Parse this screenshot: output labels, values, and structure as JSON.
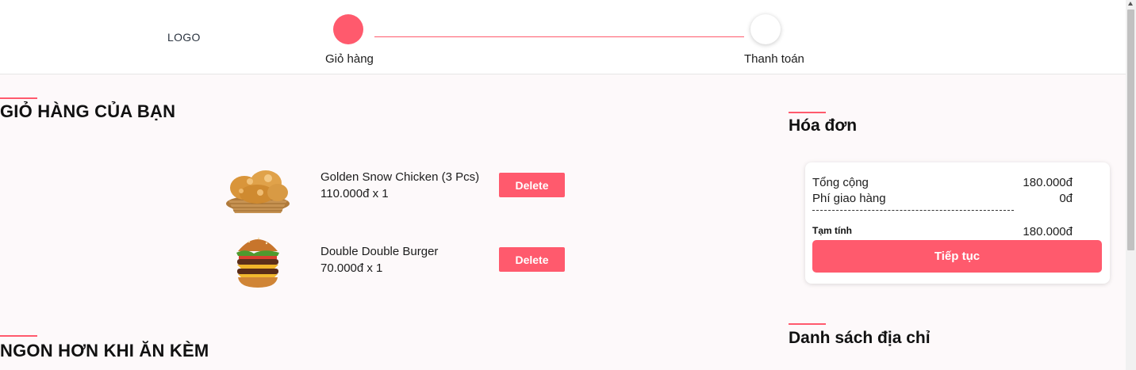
{
  "header": {
    "logo": "LOGO",
    "steps": [
      {
        "label": "Giỏ hàng",
        "active": true
      },
      {
        "label": "Thanh toán",
        "active": false
      }
    ]
  },
  "cart": {
    "title": "GIỎ HÀNG CỦA BẠN",
    "items": [
      {
        "name": "Golden Snow Chicken (3 Pcs)",
        "price_line": "110.000đ x 1",
        "delete_label": "Delete",
        "image": "fried-chicken-basket"
      },
      {
        "name": "Double Double Burger",
        "price_line": "70.000đ x 1",
        "delete_label": "Delete",
        "image": "double-burger"
      }
    ]
  },
  "sides": {
    "title": "NGON HƠN KHI ĂN KÈM"
  },
  "bill": {
    "title": "Hóa đơn",
    "total_label": "Tổng cộng",
    "total_value": "180.000đ",
    "shipping_label": "Phí giao hàng",
    "shipping_value": "0đ",
    "subtotal_label": "Tạm tính",
    "subtotal_value": "180.000đ",
    "continue_label": "Tiếp tục"
  },
  "address": {
    "title": "Danh sách địa chỉ"
  },
  "colors": {
    "accent": "#ff5a6d",
    "background": "#fdf9fa"
  }
}
